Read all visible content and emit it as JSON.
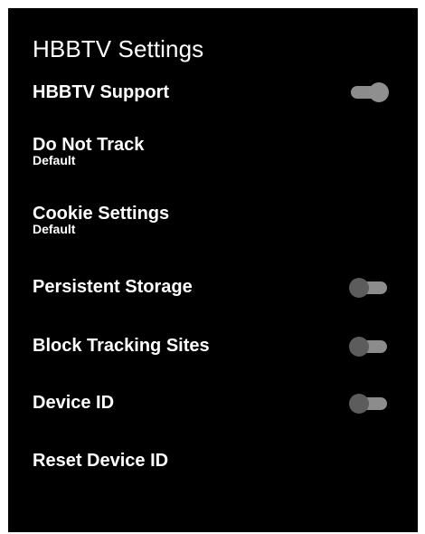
{
  "title": "HBBTV Settings",
  "items": [
    {
      "label": "HBBTV Support",
      "toggle": "on"
    },
    {
      "label": "Do Not Track",
      "sub": "Default"
    },
    {
      "label": "Cookie Settings",
      "sub": "Default"
    },
    {
      "label": "Persistent Storage",
      "toggle": "off"
    },
    {
      "label": "Block Tracking Sites",
      "toggle": "off"
    },
    {
      "label": "Device ID",
      "toggle": "off"
    },
    {
      "label": "Reset Device ID"
    }
  ]
}
